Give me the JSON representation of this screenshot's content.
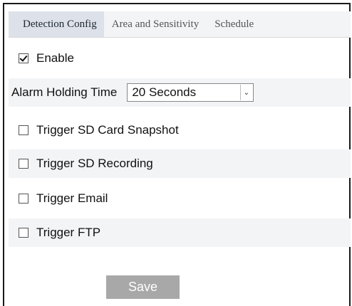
{
  "tabs": [
    {
      "label": "Detection Config",
      "active": true
    },
    {
      "label": "Area and Sensitivity",
      "active": false
    },
    {
      "label": "Schedule",
      "active": false
    }
  ],
  "enable": {
    "label": "Enable",
    "checked": true
  },
  "alarm_holding": {
    "label": "Alarm Holding Time",
    "value": "20 Seconds"
  },
  "triggers": [
    {
      "label": "Trigger SD Card Snapshot",
      "checked": false
    },
    {
      "label": "Trigger SD Recording",
      "checked": false
    },
    {
      "label": "Trigger Email",
      "checked": false
    },
    {
      "label": "Trigger FTP",
      "checked": false
    }
  ],
  "save_label": "Save",
  "colors": {
    "tab_active_bg": "#dde2ea",
    "row_shade": "#f3f4f6",
    "save_bg": "#a8a8a8"
  }
}
